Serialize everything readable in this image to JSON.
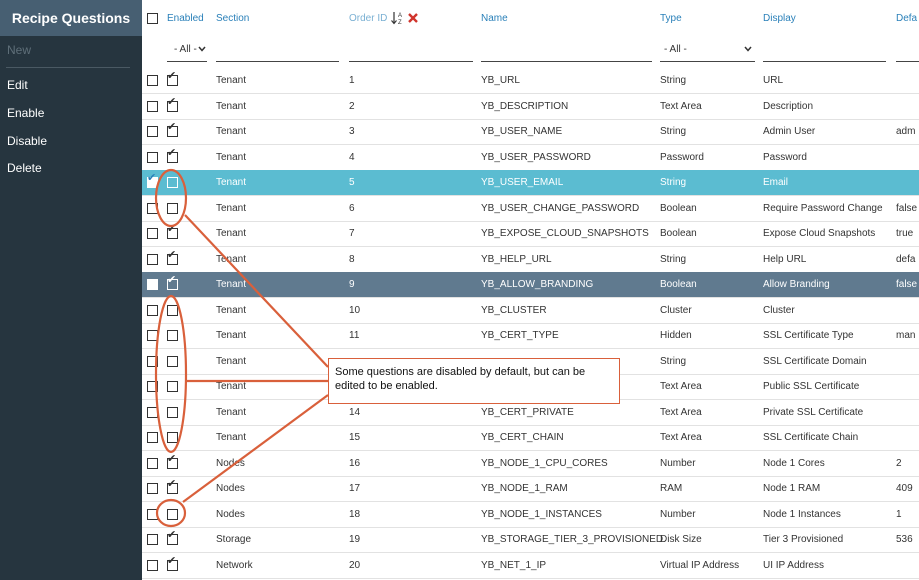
{
  "sidebar": {
    "title": "Recipe Questions",
    "items": [
      {
        "label": "New",
        "enabled": false
      },
      {
        "label": "Edit",
        "enabled": true
      },
      {
        "label": "Enable",
        "enabled": true
      },
      {
        "label": "Disable",
        "enabled": true
      },
      {
        "label": "Delete",
        "enabled": true
      }
    ]
  },
  "grid": {
    "columns": [
      "Enabled",
      "Section",
      "Order ID",
      "Name",
      "Type",
      "Display",
      "Defa"
    ],
    "filters": {
      "enabled": "- All -",
      "type": "- All -"
    },
    "rows": [
      {
        "enabled": true,
        "section": "Tenant",
        "order": "1",
        "name": "YB_URL",
        "type": "String",
        "display": "URL",
        "default": ""
      },
      {
        "enabled": true,
        "section": "Tenant",
        "order": "2",
        "name": "YB_DESCRIPTION",
        "type": "Text Area",
        "display": "Description",
        "default": ""
      },
      {
        "enabled": true,
        "section": "Tenant",
        "order": "3",
        "name": "YB_USER_NAME",
        "type": "String",
        "display": "Admin User",
        "default": "adm"
      },
      {
        "enabled": true,
        "section": "Tenant",
        "order": "4",
        "name": "YB_USER_PASSWORD",
        "type": "Password",
        "display": "Password",
        "default": ""
      },
      {
        "enabled": false,
        "section": "Tenant",
        "order": "5",
        "name": "YB_USER_EMAIL",
        "type": "String",
        "display": "Email",
        "default": "",
        "state": "selected"
      },
      {
        "enabled": false,
        "section": "Tenant",
        "order": "6",
        "name": "YB_USER_CHANGE_PASSWORD",
        "type": "Boolean",
        "display": "Require Password Change",
        "default": "false"
      },
      {
        "enabled": true,
        "section": "Tenant",
        "order": "7",
        "name": "YB_EXPOSE_CLOUD_SNAPSHOTS",
        "type": "Boolean",
        "display": "Expose Cloud Snapshots",
        "default": "true"
      },
      {
        "enabled": true,
        "section": "Tenant",
        "order": "8",
        "name": "YB_HELP_URL",
        "type": "String",
        "display": "Help URL",
        "default": "defa"
      },
      {
        "enabled": true,
        "section": "Tenant",
        "order": "9",
        "name": "YB_ALLOW_BRANDING",
        "type": "Boolean",
        "display": "Allow Branding",
        "default": "false",
        "state": "hover"
      },
      {
        "enabled": false,
        "section": "Tenant",
        "order": "10",
        "name": "YB_CLUSTER",
        "type": "Cluster",
        "display": "Cluster",
        "default": ""
      },
      {
        "enabled": false,
        "section": "Tenant",
        "order": "11",
        "name": "YB_CERT_TYPE",
        "type": "Hidden",
        "display": "SSL Certificate Type",
        "default": "man"
      },
      {
        "enabled": false,
        "section": "Tenant",
        "order": "",
        "name": "",
        "type": "String",
        "display": "SSL Certificate Domain",
        "default": ""
      },
      {
        "enabled": false,
        "section": "Tenant",
        "order": "",
        "name": "",
        "type": "Text Area",
        "display": "Public SSL Certificate",
        "default": ""
      },
      {
        "enabled": false,
        "section": "Tenant",
        "order": "14",
        "name": "YB_CERT_PRIVATE",
        "type": "Text Area",
        "display": "Private SSL Certificate",
        "default": ""
      },
      {
        "enabled": false,
        "section": "Tenant",
        "order": "15",
        "name": "YB_CERT_CHAIN",
        "type": "Text Area",
        "display": "SSL Certificate Chain",
        "default": ""
      },
      {
        "enabled": true,
        "section": "Nodes",
        "order": "16",
        "name": "YB_NODE_1_CPU_CORES",
        "type": "Number",
        "display": "Node 1 Cores",
        "default": "2"
      },
      {
        "enabled": true,
        "section": "Nodes",
        "order": "17",
        "name": "YB_NODE_1_RAM",
        "type": "RAM",
        "display": "Node 1 RAM",
        "default": "409"
      },
      {
        "enabled": false,
        "section": "Nodes",
        "order": "18",
        "name": "YB_NODE_1_INSTANCES",
        "type": "Number",
        "display": "Node 1 Instances",
        "default": "1"
      },
      {
        "enabled": true,
        "section": "Storage",
        "order": "19",
        "name": "YB_STORAGE_TIER_3_PROVISIONED",
        "type": "Disk Size",
        "display": "Tier 3 Provisioned",
        "default": "536"
      },
      {
        "enabled": true,
        "section": "Network",
        "order": "20",
        "name": "YB_NET_1_IP",
        "type": "Virtual IP Address",
        "display": "UI IP Address",
        "default": ""
      }
    ]
  },
  "callout": {
    "text": "Some questions are disabled by default, but can be edited to be enabled.",
    "color": "#d9603b"
  },
  "icons": {
    "sort": "sort-az-icon",
    "clear_sort": "red-x-icon",
    "dropdown": "chevron-down-icon",
    "check": "checkmark-icon"
  },
  "colors": {
    "sidebar": "#26353f",
    "sidebar_title": "#475f72",
    "selected_row": "#5bbcd1",
    "hover_row": "#607a8f",
    "header_text": "#2a80b9"
  }
}
